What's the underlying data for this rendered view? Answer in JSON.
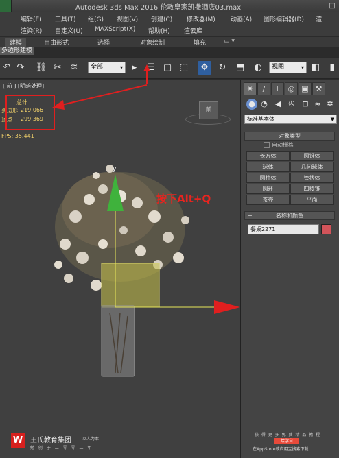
{
  "window": {
    "title": "Autodesk 3ds Max 2016    伦敦皇家凯撒酒店03.max",
    "controls": [
      "─",
      "□"
    ]
  },
  "menu_row1": [
    "编辑(E)",
    "工具(T)",
    "组(G)",
    "视图(V)",
    "创建(C)",
    "修改器(M)",
    "动画(A)",
    "图形编辑器(D)",
    "渲"
  ],
  "menu_row2": [
    "渲染(R)",
    "自定义(U)",
    "MAXScript(X)",
    "帮助(H)",
    "渲云库"
  ],
  "ribbon_tabs": [
    "建模",
    "自由形式",
    "选择",
    "对象绘制",
    "填充"
  ],
  "ribbon_subtab": "多边形建模",
  "toolbar": {
    "selection_filter": "全部",
    "ref_coord": "视图"
  },
  "viewport": {
    "label": "[ 前 ] [明暗处理]",
    "stats_header": "总计",
    "stats_polys_label": "多边形:",
    "stats_polys_value": "219,066",
    "stats_verts_label": "顶点:",
    "stats_verts_value": "299,369",
    "fps_label": "FPS:",
    "fps_value": "35.441",
    "viewcube_label": "前",
    "gizmo_axis_y": "y",
    "annotation": "按下Alt+Q"
  },
  "command_panel": {
    "tabs_icons": [
      "sun-icon",
      "curve-icon",
      "hierarchy-icon",
      "motion-icon",
      "display-icon",
      "utilities-icon"
    ],
    "create_icons": [
      "geometry-icon",
      "shapes-icon",
      "lights-icon",
      "cameras-icon",
      "helpers-icon",
      "spacewarps-icon",
      "systems-icon"
    ],
    "category": "标准基本体",
    "object_type_title": "对象类型",
    "autogrid_label": "自动栅格",
    "object_buttons": [
      "长方体",
      "圆锥体",
      "球体",
      "几何球体",
      "圆柱体",
      "管状体",
      "圆环",
      "四棱锥",
      "茶壶",
      "平面"
    ],
    "name_color_title": "名称和颜色",
    "object_name": "餐桌2271",
    "object_color": "#d2545a"
  },
  "watermark": {
    "logo_letter": "W",
    "brand": "王氏教育集团",
    "slogan": "以人为本",
    "sub": "勉 创 于 二 零 零 二 年",
    "promo_line1": "获 得 更 多 免 费 精 品 教 程",
    "promo_badge": "给学自",
    "promo_line2": "在AppStore或应用宝搜索下载"
  },
  "colors": {
    "annotation_red": "#e8241f",
    "stats_yellow": "#f3d36b",
    "gizmo_green": "#3fb23c",
    "panel_gray": "#444444"
  }
}
